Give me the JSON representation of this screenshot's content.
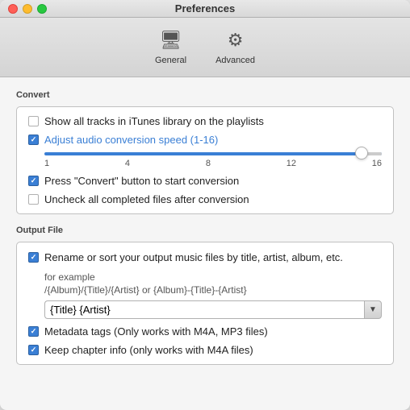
{
  "window": {
    "title": "Preferences"
  },
  "tabs": [
    {
      "id": "general",
      "label": "General",
      "icon": "🖥"
    },
    {
      "id": "advanced",
      "label": "Advanced",
      "icon": "⚙"
    }
  ],
  "sections": {
    "convert": {
      "title": "Convert",
      "items": [
        {
          "id": "show-tracks",
          "label": "Show all tracks in iTunes library on the playlists",
          "checked": false
        },
        {
          "id": "adjust-speed",
          "label": "Adjust audio conversion speed (1-16)",
          "checked": true
        },
        {
          "id": "press-convert",
          "label": "Press \"Convert\" button to start conversion",
          "checked": true
        },
        {
          "id": "uncheck-completed",
          "label": "Uncheck all completed files after conversion",
          "checked": false
        }
      ],
      "slider": {
        "labels": [
          "1",
          "4",
          "8",
          "12",
          "16"
        ],
        "value": 15
      }
    },
    "output": {
      "title": "Output File",
      "rename": {
        "id": "rename-sort",
        "label": "Rename or sort your output music files by title, artist, album, etc.",
        "checked": true
      },
      "for_example": "for example",
      "example_template": "/{Album}/{Title}/{Artist} or {Album}-{Title}-{Artist}",
      "input_value": "{Title} {Artist}",
      "input_placeholder": "{Title} {Artist}",
      "dropdown_arrow": "▼",
      "extras": [
        {
          "id": "metadata-tags",
          "label": "Metadata tags (Only works with M4A, MP3 files)",
          "checked": true
        },
        {
          "id": "keep-chapter",
          "label": "Keep chapter info (only works with  M4A files)",
          "checked": true
        }
      ]
    }
  }
}
